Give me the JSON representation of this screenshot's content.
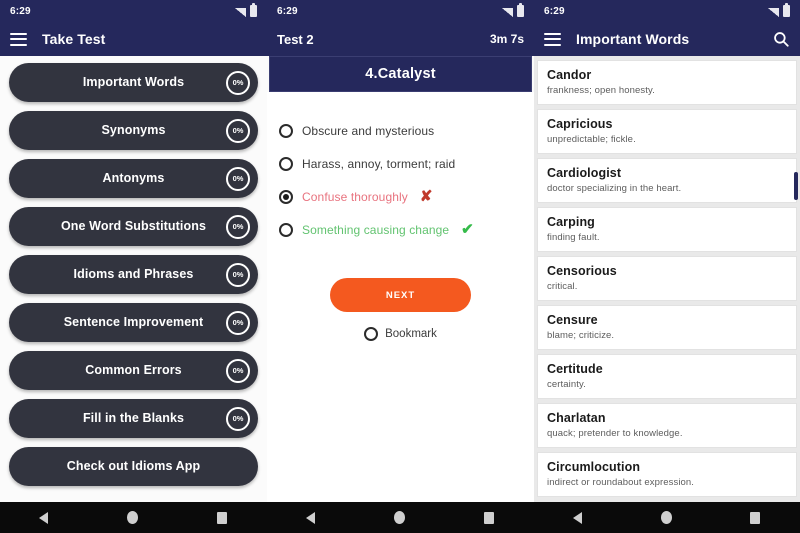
{
  "panel1": {
    "status": {
      "clock": "6:29",
      "signal_icon": "signal-icon",
      "battery_icon": "battery-icon"
    },
    "appbar": {
      "menu_icon": "hamburger-icon",
      "title": "Take Test"
    },
    "buttons": [
      {
        "label": "Important Words",
        "pct": "0%"
      },
      {
        "label": "Synonyms",
        "pct": "0%"
      },
      {
        "label": "Antonyms",
        "pct": "0%"
      },
      {
        "label": "One Word Substitutions",
        "pct": "0%"
      },
      {
        "label": "Idioms and Phrases",
        "pct": "0%"
      },
      {
        "label": "Sentence Improvement",
        "pct": "0%"
      },
      {
        "label": "Common Errors",
        "pct": "0%"
      },
      {
        "label": "Fill in the Blanks",
        "pct": "0%"
      },
      {
        "label": "Check out Idioms App",
        "pct": ""
      }
    ]
  },
  "panel2": {
    "status": {
      "clock": "6:29",
      "signal_icon": "signal-icon",
      "battery_icon": "battery-icon"
    },
    "topbar": {
      "test_name": "Test 2",
      "timer": "3m 7s"
    },
    "question": {
      "title": "4.Catalyst"
    },
    "options": [
      {
        "text": "Obscure and mysterious",
        "selected": false,
        "state": "neutral",
        "mark": ""
      },
      {
        "text": "Harass, annoy, torment; raid",
        "selected": false,
        "state": "neutral",
        "mark": ""
      },
      {
        "text": "Confuse thoroughly",
        "selected": true,
        "state": "wrong",
        "mark": "✘"
      },
      {
        "text": "Something causing change",
        "selected": false,
        "state": "right",
        "mark": "✔"
      }
    ],
    "next_label": "NEXT",
    "bookmark_label": "Bookmark",
    "accent_color": "#f4591f"
  },
  "panel3": {
    "status": {
      "clock": "6:29",
      "signal_icon": "signal-icon",
      "battery_icon": "battery-icon"
    },
    "appbar": {
      "menu_icon": "hamburger-icon",
      "title": "Important Words",
      "search_icon": "search-icon"
    },
    "words": [
      {
        "word": "Candor",
        "definition": "frankness; open honesty."
      },
      {
        "word": "Capricious",
        "definition": "unpredictable; fickle."
      },
      {
        "word": "Cardiologist",
        "definition": "doctor specializing in the heart."
      },
      {
        "word": "Carping",
        "definition": "finding fault."
      },
      {
        "word": "Censorious",
        "definition": "critical."
      },
      {
        "word": "Censure",
        "definition": "blame; criticize."
      },
      {
        "word": "Certitude",
        "definition": "certainty."
      },
      {
        "word": "Charlatan",
        "definition": "quack; pretender to knowledge."
      },
      {
        "word": "Circumlocution",
        "definition": "indirect or roundabout expression."
      }
    ]
  },
  "navbar": {
    "back_icon": "back-triangle-icon",
    "home_icon": "home-circle-icon",
    "recent_icon": "recents-square-icon"
  },
  "theme": {
    "primary": "#25285c",
    "button_dark": "#32343f",
    "accent": "#f4591f",
    "correct": "#62c370",
    "wrong": "#e8737f"
  }
}
